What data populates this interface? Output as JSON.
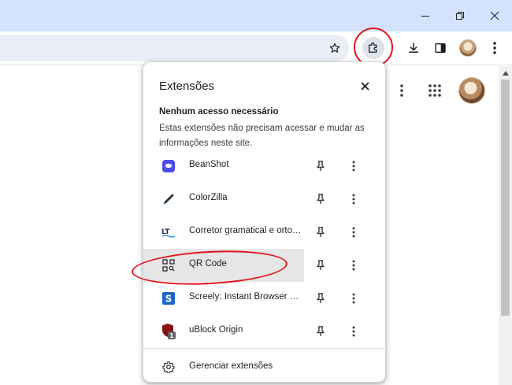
{
  "window": {
    "controls": [
      {
        "id": "minimize",
        "icon": "minimize-icon"
      },
      {
        "id": "maximize",
        "icon": "restore-icon"
      },
      {
        "id": "close",
        "icon": "close-icon"
      }
    ]
  },
  "toolbar": {
    "icons": [
      "star-icon",
      "puzzle-icon",
      "download-icon",
      "side-panel-icon",
      "profile-avatar",
      "kebab-menu-icon"
    ]
  },
  "extensions_popup": {
    "title": "Extensões",
    "section_title": "Nenhum acesso necessário",
    "section_description": "Estas extensões não precisam acessar e mudar as informações neste site.",
    "items": [
      {
        "name": "BeanShot",
        "icon": "beanshot-icon"
      },
      {
        "name": "ColorZilla",
        "icon": "eyedropper-icon"
      },
      {
        "name": "Corretor gramatical e ortográfico",
        "icon": "languagetool-icon"
      },
      {
        "name": "QR Code",
        "icon": "qr-code-icon"
      },
      {
        "name": "Screely: Instant Browser Mockups",
        "icon": "screely-icon"
      },
      {
        "name": "uBlock Origin",
        "icon": "ublock-icon",
        "badge": "1"
      }
    ],
    "manage_label": "Gerenciar extensões"
  },
  "colors": {
    "titlebar": "#d3e3fd",
    "omnibox": "#e9eef6",
    "annotation_red": "#e0131b",
    "hover_row": "#e6e6e6"
  }
}
